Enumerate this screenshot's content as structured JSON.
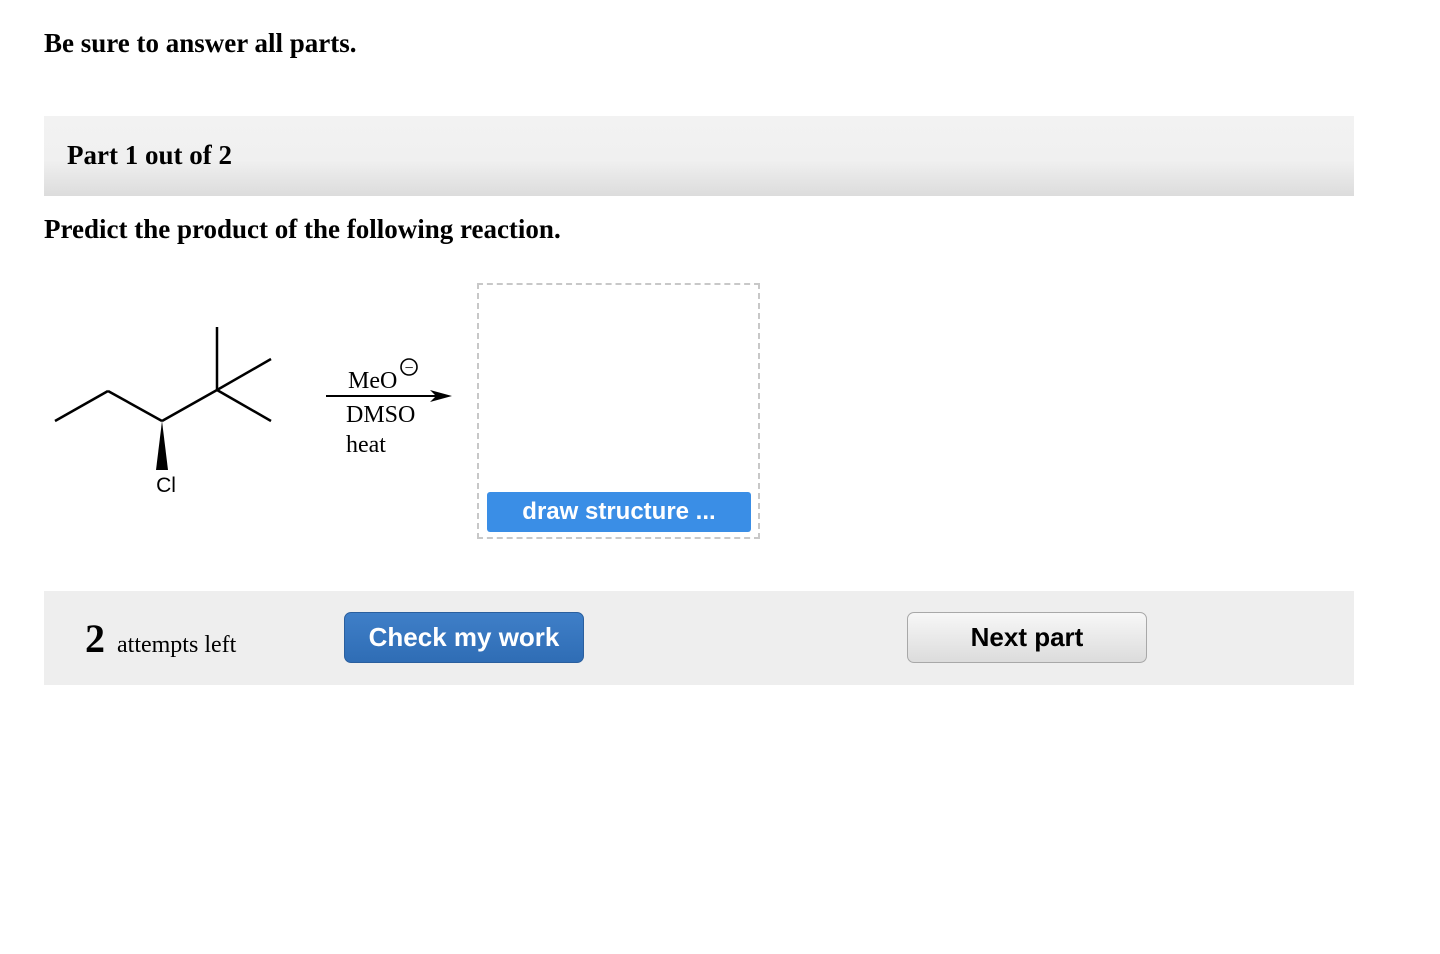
{
  "instruction": "Be sure to answer all parts.",
  "part_header": {
    "label": "Part 1 out of 2"
  },
  "question": "Predict the product of the following reaction.",
  "reaction": {
    "substituent_label": "Cl",
    "reagents": {
      "line1": "MeO",
      "charge_symbol": "−",
      "line2": "DMSO",
      "line3": "heat"
    }
  },
  "answer_box": {
    "draw_button_label": "draw structure ..."
  },
  "footer": {
    "attempts_count": "2",
    "attempts_label": "attempts left",
    "check_button_label": "Check my work",
    "next_button_label": "Next part"
  }
}
